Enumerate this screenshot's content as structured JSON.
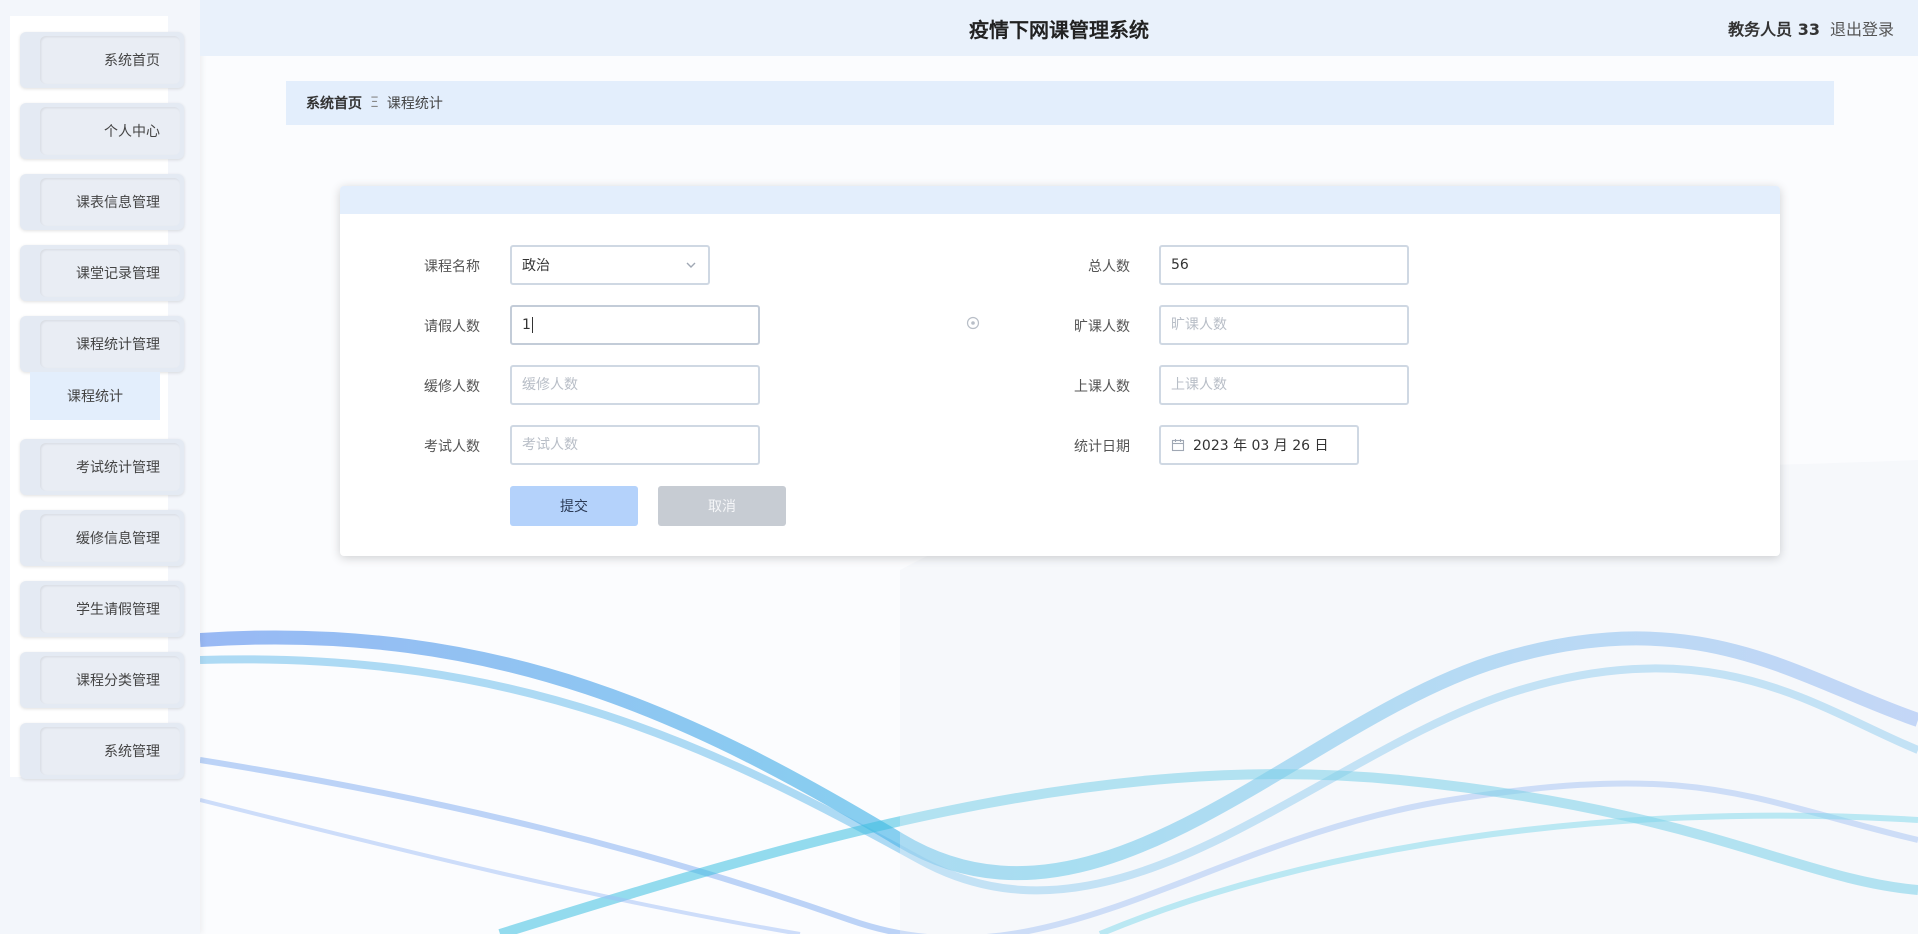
{
  "header": {
    "title": "疫情下网课管理系统",
    "user": "教务人员 33",
    "logout": "退出登录"
  },
  "sidebar": {
    "items": [
      {
        "label": "系统首页"
      },
      {
        "label": "个人中心"
      },
      {
        "label": "课表信息管理"
      },
      {
        "label": "课堂记录管理"
      },
      {
        "label": "课程统计管理"
      },
      {
        "label": "考试统计管理"
      },
      {
        "label": "缓修信息管理"
      },
      {
        "label": "学生请假管理"
      },
      {
        "label": "课程分类管理"
      },
      {
        "label": "系统管理"
      }
    ],
    "submenu": {
      "label": "课程统计"
    }
  },
  "breadcrumb": {
    "home": "系统首页",
    "separator": "Ξ",
    "current": "课程统计"
  },
  "form": {
    "course_name": {
      "label": "课程名称",
      "value": "政治"
    },
    "total": {
      "label": "总人数",
      "value": "56"
    },
    "leave": {
      "label": "请假人数",
      "value": "1"
    },
    "absent": {
      "label": "旷课人数",
      "placeholder": "旷课人数"
    },
    "deferred": {
      "label": "缓修人数",
      "placeholder": "缓修人数"
    },
    "attend": {
      "label": "上课人数",
      "placeholder": "上课人数"
    },
    "exam": {
      "label": "考试人数",
      "placeholder": "考试人数"
    },
    "date": {
      "label": "统计日期",
      "value": "2023 年 03 月 26 日"
    },
    "submit": "提交",
    "cancel": "取消"
  },
  "colors": {
    "accent": "#b4d2fb",
    "header_bg": "#e9f1fb",
    "cancel_bg": "#c7ccd3"
  }
}
